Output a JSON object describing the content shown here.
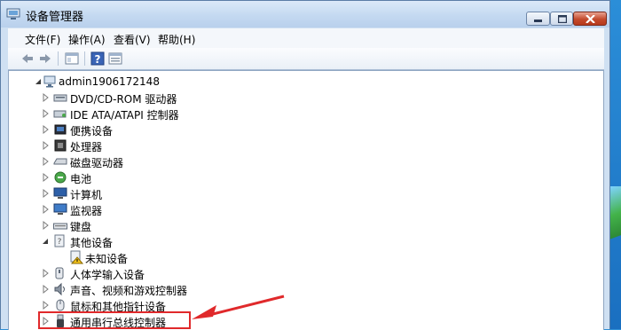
{
  "window": {
    "title": "设备管理器",
    "buttons": {
      "minimize": "minimize",
      "maximize": "maximize",
      "close": "close"
    }
  },
  "menu": {
    "items": [
      "文件(F)",
      "操作(A)",
      "查看(V)",
      "帮助(H)"
    ]
  },
  "toolbar": {
    "icons": [
      "back-icon",
      "forward-icon",
      "properties-pane-icon",
      "help-icon",
      "view-icon"
    ]
  },
  "tree": {
    "root": "admin1906172148",
    "items": [
      {
        "label": "DVD/CD-ROM 驱动器",
        "icon": "dvd-drive-icon",
        "expanded": false
      },
      {
        "label": "IDE ATA/ATAPI 控制器",
        "icon": "ide-controller-icon",
        "expanded": false
      },
      {
        "label": "便携设备",
        "icon": "portable-device-icon",
        "expanded": false
      },
      {
        "label": "处理器",
        "icon": "processor-icon",
        "expanded": false
      },
      {
        "label": "磁盘驱动器",
        "icon": "disk-drive-icon",
        "expanded": false
      },
      {
        "label": "电池",
        "icon": "battery-icon",
        "expanded": false
      },
      {
        "label": "计算机",
        "icon": "computer-icon",
        "expanded": false
      },
      {
        "label": "监视器",
        "icon": "monitor-icon",
        "expanded": false
      },
      {
        "label": "键盘",
        "icon": "keyboard-icon",
        "expanded": false
      },
      {
        "label": "其他设备",
        "icon": "other-devices-icon",
        "expanded": true,
        "children": [
          {
            "label": "未知设备",
            "icon": "unknown-device-warning-icon"
          }
        ]
      },
      {
        "label": "人体学输入设备",
        "icon": "hid-icon",
        "expanded": false
      },
      {
        "label": "声音、视频和游戏控制器",
        "icon": "sound-icon",
        "expanded": false
      },
      {
        "label": "鼠标和其他指针设备",
        "icon": "mouse-icon",
        "expanded": false
      },
      {
        "label": "通用串行总线控制器",
        "icon": "usb-icon",
        "expanded": false,
        "highlighted": true
      }
    ]
  },
  "annotation": {
    "color": "#e0292b"
  }
}
